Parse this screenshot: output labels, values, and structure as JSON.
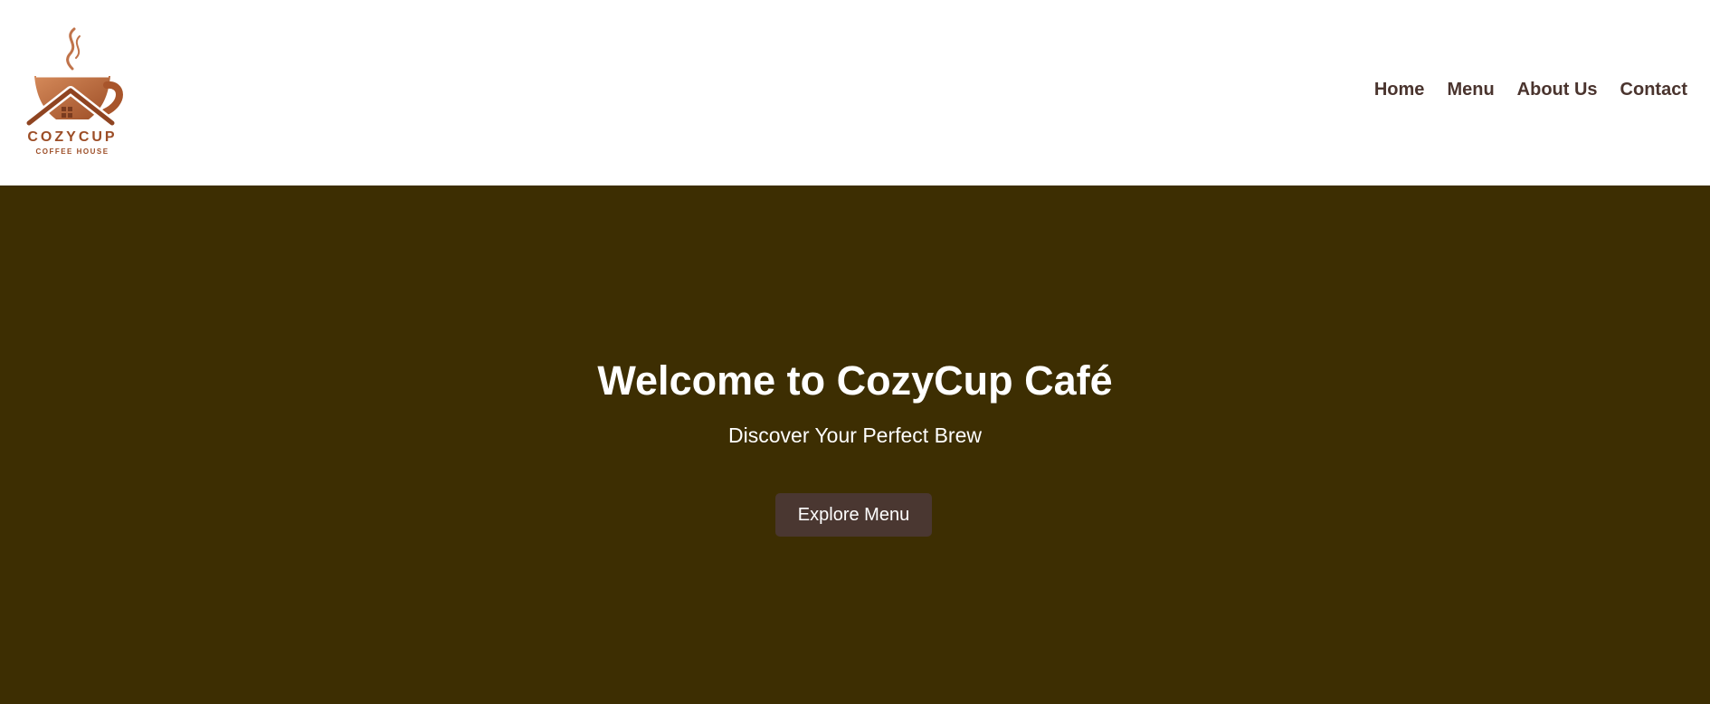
{
  "brand": {
    "name": "COZYCUP",
    "tagline": "COFFEE HOUSE",
    "primary_color": "#b8673d",
    "dark_color": "#7a3b1f"
  },
  "nav": {
    "items": [
      {
        "label": "Home"
      },
      {
        "label": "Menu"
      },
      {
        "label": "About Us"
      },
      {
        "label": "Contact"
      }
    ],
    "text_color": "#4a342e"
  },
  "hero": {
    "title": "Welcome to CozyCup Café",
    "subtitle": "Discover Your Perfect Brew",
    "button_label": "Explore Menu",
    "background": "#3d2e02",
    "button_color": "#4a3731"
  }
}
